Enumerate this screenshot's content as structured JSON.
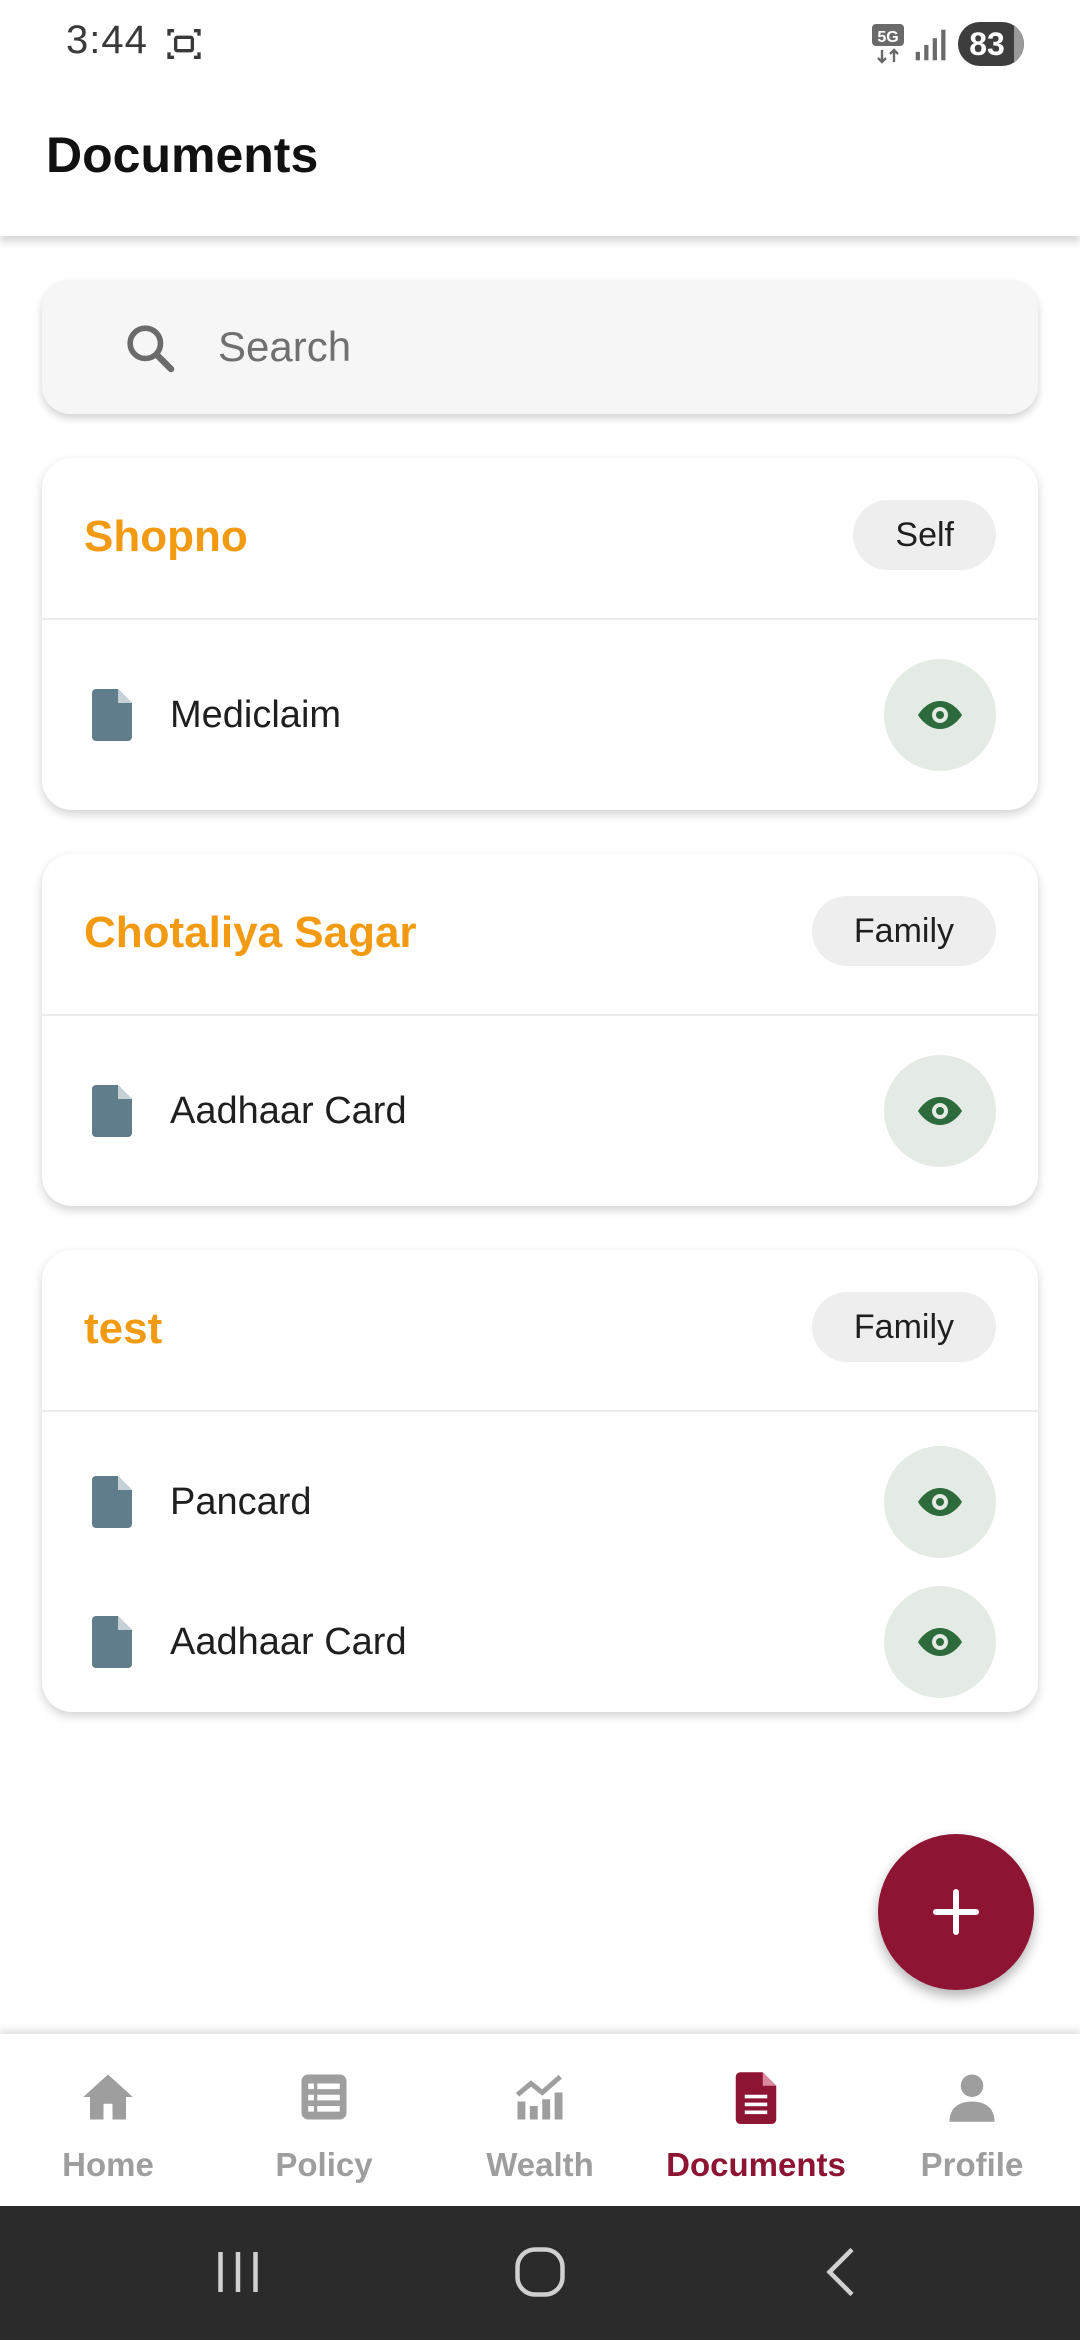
{
  "status_bar": {
    "time": "3:44",
    "network": "5G",
    "battery": "83"
  },
  "header": {
    "title": "Documents"
  },
  "search": {
    "placeholder": "Search",
    "value": ""
  },
  "groups": [
    {
      "name": "Shopno",
      "relation": "Self",
      "documents": [
        {
          "label": "Mediclaim"
        }
      ]
    },
    {
      "name": "Chotaliya Sagar",
      "relation": "Family",
      "documents": [
        {
          "label": "Aadhaar Card"
        }
      ]
    },
    {
      "name": "test",
      "relation": "Family",
      "documents": [
        {
          "label": "Pancard"
        },
        {
          "label": "Aadhaar Card"
        }
      ]
    }
  ],
  "bottom_nav": {
    "items": [
      {
        "label": "Home",
        "icon": "home-icon"
      },
      {
        "label": "Policy",
        "icon": "list-icon"
      },
      {
        "label": "Wealth",
        "icon": "chart-icon"
      },
      {
        "label": "Documents",
        "icon": "document-icon",
        "active": true
      },
      {
        "label": "Profile",
        "icon": "person-icon"
      }
    ]
  },
  "colors": {
    "accent": "#8d1533",
    "name_orange": "#f29a12",
    "doc_icon": "#607d8b",
    "eye_icon": "#2e6b3c",
    "inactive_nav": "#9e9e9e"
  }
}
